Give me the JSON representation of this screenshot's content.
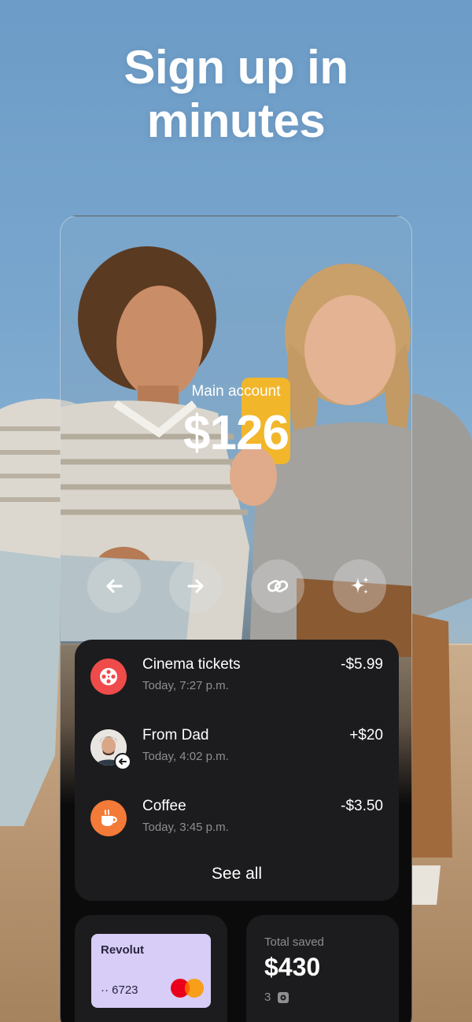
{
  "hero": {
    "title_line1": "Sign up in",
    "title_line2": "minutes"
  },
  "account": {
    "label": "Main account",
    "balance": "$126"
  },
  "actions": [
    {
      "name": "send",
      "icon": "arrow-left-icon"
    },
    {
      "name": "receive",
      "icon": "arrow-right-icon"
    },
    {
      "name": "link",
      "icon": "link-icon"
    },
    {
      "name": "more",
      "icon": "sparkle-icon"
    }
  ],
  "transactions": [
    {
      "title": "Cinema tickets",
      "time": "Today, 7:27 p.m.",
      "amount": "-$5.99",
      "icon": "film-reel-icon",
      "icon_color": "#f04b4b"
    },
    {
      "title": "From Dad",
      "time": "Today, 4:02 p.m.",
      "amount": "+$20",
      "icon": "avatar",
      "icon_color": "#e9e6e2"
    },
    {
      "title": "Coffee",
      "time": "Today, 3:45 p.m.",
      "amount": "-$3.50",
      "icon": "coffee-cup-icon",
      "icon_color": "#f47a37"
    }
  ],
  "see_all": "See all",
  "card": {
    "brand": "Revolut",
    "number": "·· 6723",
    "color": "#d7cdf6"
  },
  "savings": {
    "label": "Total saved",
    "value": "$430",
    "count": "3"
  }
}
